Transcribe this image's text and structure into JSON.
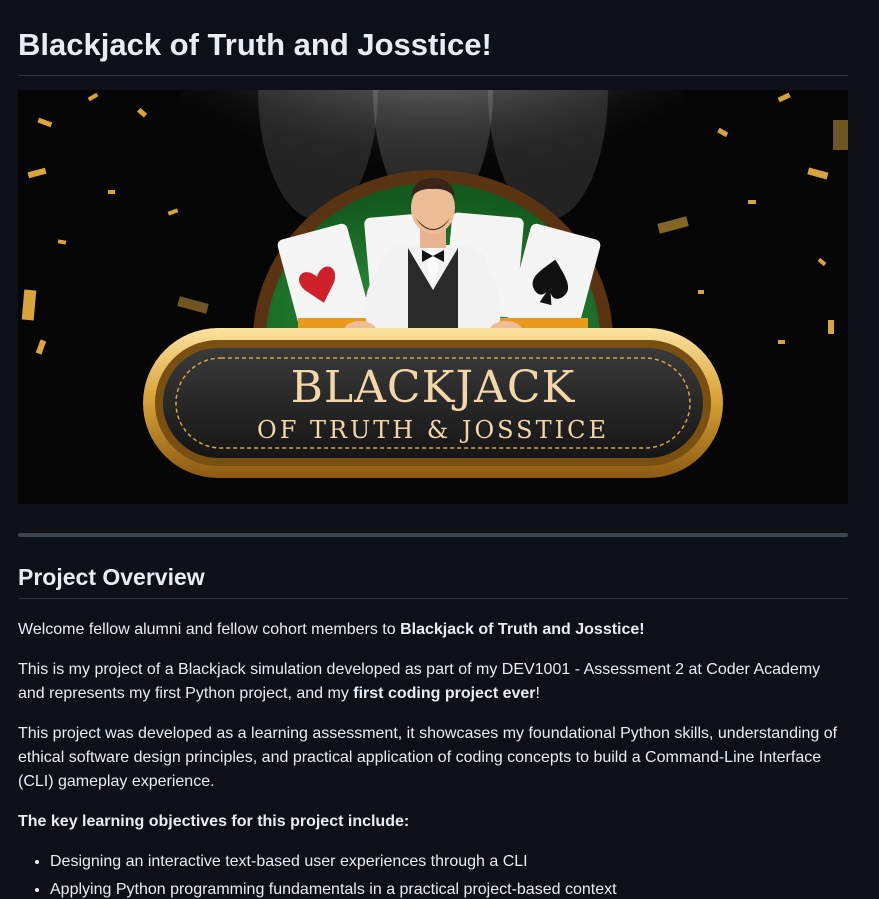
{
  "page": {
    "title": "Blackjack of Truth and Josstice!"
  },
  "banner": {
    "logo_line1": "BLACKJACK",
    "logo_line2": "OF TRUTH & JOSSTICE"
  },
  "overview": {
    "heading": "Project Overview",
    "p1_prefix": "Welcome fellow alumni and fellow cohort members to ",
    "p1_bold": "Blackjack of Truth and Josstice!",
    "p2_prefix": "This is my project of a Blackjack simulation developed as part of my DEV1001 - Assessment 2 at Coder Academy and represents my first Python project, and my ",
    "p2_bold": "first coding project ever",
    "p2_suffix": "!",
    "p3": "This project was developed as a learning assessment, it showcases my foundational Python skills, understanding of ethical software design principles, and practical application of coding concepts to build a Command-Line Interface (CLI) gameplay experience.",
    "objectives_heading": "The key learning objectives for this project include:",
    "objectives": [
      "Designing an interactive text-based user experiences through a CLI",
      "Applying Python programming fundamentals in a practical project-based context"
    ]
  },
  "colors": {
    "background": "#0d1117",
    "text": "#e6edf3",
    "border": "#30363d",
    "gold": "#d4a437",
    "felt_green": "#1f7a2e"
  }
}
